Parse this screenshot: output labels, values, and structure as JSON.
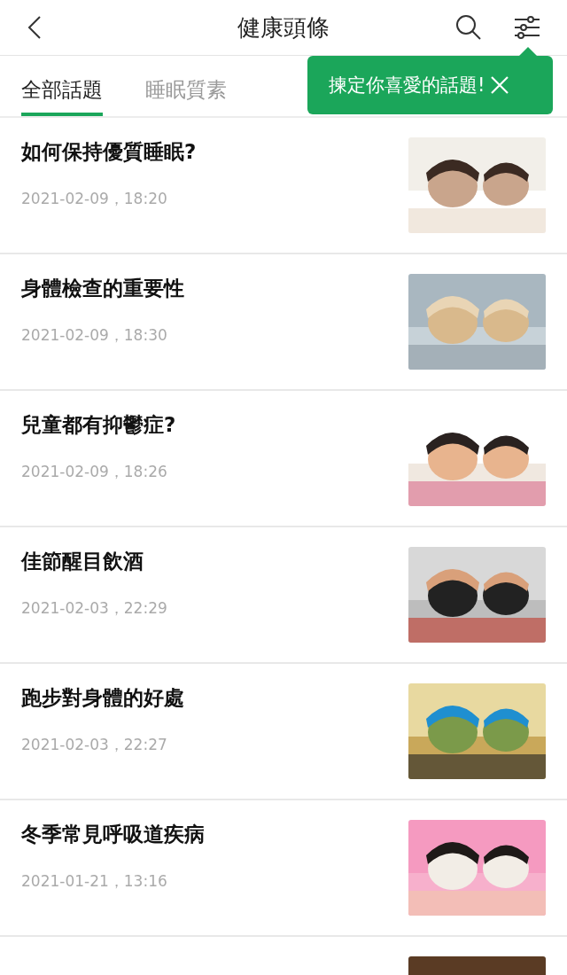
{
  "header": {
    "title": "健康頭條"
  },
  "tabs": [
    {
      "label": "全部話題",
      "selected": true
    },
    {
      "label": "睡眠質素",
      "selected": false
    }
  ],
  "tooltip": {
    "text": "揀定你喜愛的話題!"
  },
  "articles": [
    {
      "kind": "article",
      "title": "如何保持優質睡眠?",
      "date": "2021-02-09，18:20"
    },
    {
      "kind": "article",
      "title": "身體檢查的重要性",
      "date": "2021-02-09，18:30"
    },
    {
      "kind": "article",
      "title": "兒童都有抑鬱症?",
      "date": "2021-02-09，18:26"
    },
    {
      "kind": "article",
      "title": "佳節醒目飲酒",
      "date": "2021-02-03，22:29"
    },
    {
      "kind": "article",
      "title": "跑步對身體的好處",
      "date": "2021-02-03，22:27"
    },
    {
      "kind": "article",
      "title": "冬季常見呼吸道疾病",
      "date": "2021-01-21，13:16"
    },
    {
      "kind": "partial"
    }
  ]
}
